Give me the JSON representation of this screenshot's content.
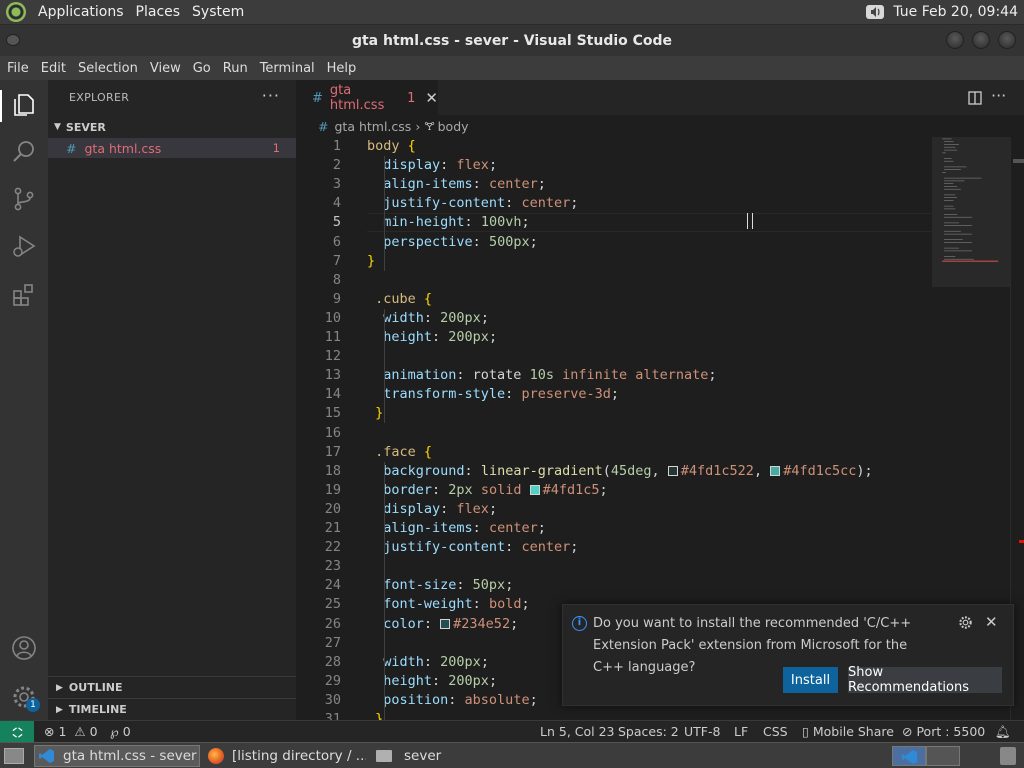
{
  "system_panel": {
    "menus": [
      "Applications",
      "Places",
      "System"
    ],
    "clock": "Tue Feb 20, 09:44"
  },
  "window": {
    "title": "gta html.css - sever - Visual Studio Code"
  },
  "menubar": [
    "File",
    "Edit",
    "Selection",
    "View",
    "Go",
    "Run",
    "Terminal",
    "Help"
  ],
  "activity_bar": {
    "icons": [
      "explorer-icon",
      "search-icon",
      "source-control-icon",
      "run-debug-icon",
      "extensions-icon",
      "account-icon",
      "settings-gear-icon"
    ],
    "settings_badge": "1"
  },
  "sidebar": {
    "title": "EXPLORER",
    "folder": "SEVER",
    "file": {
      "icon": "#",
      "name": "gta html.css",
      "problems": "1"
    },
    "outline": "OUTLINE",
    "timeline": "TIMELINE"
  },
  "tab": {
    "icon": "#",
    "label": "gta html.css",
    "problems": "1"
  },
  "breadcrumb": {
    "file": "gta html.css",
    "symbol": "body"
  },
  "colors": {
    "accent": "#0e639c",
    "remote": "#16825d",
    "error": "#e06c75",
    "selector": "#d7ba7d",
    "property": "#9cdcfe",
    "value": "#ce9178"
  },
  "editor": {
    "current_line": 5,
    "lines": [
      {
        "n": "1",
        "t": [
          [
            "sel",
            "body "
          ],
          [
            "brace",
            "{"
          ]
        ]
      },
      {
        "n": "2",
        "t": [
          [
            "prop",
            "  display"
          ],
          [
            "",
            ": "
          ],
          [
            "val",
            "flex"
          ],
          [
            "",
            ";"
          ]
        ]
      },
      {
        "n": "3",
        "t": [
          [
            "prop",
            "  align-items"
          ],
          [
            "",
            ": "
          ],
          [
            "val",
            "center"
          ],
          [
            "",
            ";"
          ]
        ]
      },
      {
        "n": "4",
        "t": [
          [
            "prop",
            "  justify-content"
          ],
          [
            "",
            ": "
          ],
          [
            "val",
            "center"
          ],
          [
            "",
            ";"
          ]
        ]
      },
      {
        "n": "5",
        "t": [
          [
            "prop",
            "  min-height"
          ],
          [
            "",
            ": "
          ],
          [
            "num",
            "100vh"
          ],
          [
            "",
            ";"
          ]
        ]
      },
      {
        "n": "6",
        "t": [
          [
            "prop",
            "  perspective"
          ],
          [
            "",
            ": "
          ],
          [
            "num",
            "500px"
          ],
          [
            "",
            ";"
          ]
        ]
      },
      {
        "n": "7",
        "t": [
          [
            "brace",
            "}"
          ]
        ]
      },
      {
        "n": "8",
        "t": []
      },
      {
        "n": "9",
        "t": [
          [
            "sel",
            " .cube "
          ],
          [
            "brace",
            "{"
          ]
        ]
      },
      {
        "n": "10",
        "t": [
          [
            "prop",
            "  width"
          ],
          [
            "",
            ": "
          ],
          [
            "num",
            "200px"
          ],
          [
            "",
            ";"
          ]
        ]
      },
      {
        "n": "11",
        "t": [
          [
            "prop",
            "  height"
          ],
          [
            "",
            ": "
          ],
          [
            "num",
            "200px"
          ],
          [
            "",
            ";"
          ]
        ]
      },
      {
        "n": "12",
        "t": []
      },
      {
        "n": "13",
        "t": [
          [
            "prop",
            "  animation"
          ],
          [
            "",
            ": rotate "
          ],
          [
            "num",
            "10s"
          ],
          [
            "",
            " "
          ],
          [
            "val",
            "infinite alternate"
          ],
          [
            "",
            ";"
          ]
        ]
      },
      {
        "n": "14",
        "t": [
          [
            "prop",
            "  transform-style"
          ],
          [
            "",
            ": "
          ],
          [
            "val",
            "preserve-3d"
          ],
          [
            "",
            ";"
          ]
        ]
      },
      {
        "n": "15",
        "t": [
          [
            "brace",
            " }"
          ]
        ]
      },
      {
        "n": "16",
        "t": []
      },
      {
        "n": "17",
        "t": [
          [
            "sel",
            " .face "
          ],
          [
            "brace",
            "{"
          ]
        ]
      },
      {
        "n": "18",
        "t": [
          [
            "prop",
            "  background"
          ],
          [
            "",
            ": "
          ],
          [
            "fn",
            "linear-gradient"
          ],
          [
            "",
            "("
          ],
          [
            "num",
            "45deg"
          ],
          [
            "",
            ", "
          ],
          [
            "sw:#4fd1c522",
            ""
          ],
          [
            "val",
            "#4fd1c522"
          ],
          [
            "",
            ", "
          ],
          [
            "sw:#4fd1c5cc",
            ""
          ],
          [
            "val",
            "#4fd1c5cc"
          ],
          [
            "",
            ");"
          ]
        ]
      },
      {
        "n": "19",
        "t": [
          [
            "prop",
            "  border"
          ],
          [
            "",
            ": "
          ],
          [
            "num",
            "2px"
          ],
          [
            "",
            " "
          ],
          [
            "val",
            "solid "
          ],
          [
            "sw:#4fd1c5",
            ""
          ],
          [
            "val",
            "#4fd1c5"
          ],
          [
            "",
            ";"
          ]
        ]
      },
      {
        "n": "20",
        "t": [
          [
            "prop",
            "  display"
          ],
          [
            "",
            ": "
          ],
          [
            "val",
            "flex"
          ],
          [
            "",
            ";"
          ]
        ]
      },
      {
        "n": "21",
        "t": [
          [
            "prop",
            "  align-items"
          ],
          [
            "",
            ": "
          ],
          [
            "val",
            "center"
          ],
          [
            "",
            ";"
          ]
        ]
      },
      {
        "n": "22",
        "t": [
          [
            "prop",
            "  justify-content"
          ],
          [
            "",
            ": "
          ],
          [
            "val",
            "center"
          ],
          [
            "",
            ";"
          ]
        ]
      },
      {
        "n": "23",
        "t": []
      },
      {
        "n": "24",
        "t": [
          [
            "prop",
            "  font-size"
          ],
          [
            "",
            ": "
          ],
          [
            "num",
            "50px"
          ],
          [
            "",
            ";"
          ]
        ]
      },
      {
        "n": "25",
        "t": [
          [
            "prop",
            "  font-weight"
          ],
          [
            "",
            ": "
          ],
          [
            "val",
            "bold"
          ],
          [
            "",
            ";"
          ]
        ]
      },
      {
        "n": "26",
        "t": [
          [
            "prop",
            "  color"
          ],
          [
            "",
            ": "
          ],
          [
            "sw:#234e52",
            ""
          ],
          [
            "val",
            "#234e52"
          ],
          [
            "",
            ";"
          ]
        ]
      },
      {
        "n": "27",
        "t": []
      },
      {
        "n": "28",
        "t": [
          [
            "prop",
            "  width"
          ],
          [
            "",
            ": "
          ],
          [
            "num",
            "200px"
          ],
          [
            "",
            ";"
          ]
        ]
      },
      {
        "n": "29",
        "t": [
          [
            "prop",
            "  height"
          ],
          [
            "",
            ": "
          ],
          [
            "num",
            "200px"
          ],
          [
            "",
            ";"
          ]
        ]
      },
      {
        "n": "30",
        "t": [
          [
            "prop",
            "  position"
          ],
          [
            "",
            ": "
          ],
          [
            "val",
            "absolute"
          ],
          [
            "",
            ";"
          ]
        ]
      },
      {
        "n": "31",
        "t": [
          [
            "brace",
            " }"
          ]
        ]
      }
    ]
  },
  "notification": {
    "message": "Do you want to install the recommended 'C/C++ Extension Pack' extension from Microsoft for the C++ language?",
    "install": "Install",
    "show_recommendations": "Show Recommendations"
  },
  "statusbar": {
    "errors": "1",
    "warnings": "0",
    "ports": "0",
    "position": "Ln 5, Col 23",
    "spaces": "Spaces: 2",
    "encoding": "UTF-8",
    "eol": "LF",
    "language": "CSS",
    "mobile_share": "Mobile Share",
    "port": "Port : 5500"
  },
  "taskbar": {
    "tasks": [
      "gta html.css - sever ...",
      "[listing directory / ...",
      "sever"
    ]
  }
}
